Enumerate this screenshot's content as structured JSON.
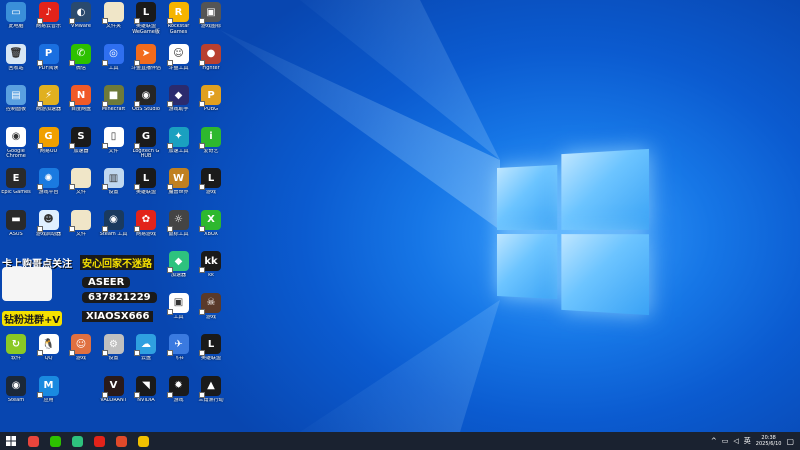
{
  "desktop_icons": [
    {
      "label": "此电脑",
      "color": "#3a8fd9",
      "glyph": "▭"
    },
    {
      "label": "网易云音乐",
      "color": "#e2231a",
      "glyph": "♪"
    },
    {
      "label": "VMware",
      "color": "#2a4a6e",
      "glyph": "◐"
    },
    {
      "label": "文件夹",
      "color": "#f0e6c8",
      "glyph": ""
    },
    {
      "label": "英雄联盟 WeGame版",
      "color": "#1a1a1a",
      "glyph": "L"
    },
    {
      "label": "Rockstar Games",
      "color": "#f5b400",
      "glyph": "R"
    },
    {
      "label": "游戏图标",
      "color": "#555",
      "glyph": "▣"
    },
    {
      "label": "回收站",
      "color": "#d6e6f5",
      "glyph": "🗑"
    },
    {
      "label": "PDF阅读",
      "color": "#1a6fe0",
      "glyph": "P"
    },
    {
      "label": "微信",
      "color": "#2dc100",
      "glyph": "✆"
    },
    {
      "label": "工具",
      "color": "#2f6ff0",
      "glyph": "◎"
    },
    {
      "label": "斗鱼直播伴侣",
      "color": "#f26b1d",
      "glyph": "➤"
    },
    {
      "label": "斗鱼工具",
      "color": "#ffffff",
      "glyph": "☺"
    },
    {
      "label": "Fighter",
      "color": "#b84030",
      "glyph": "●"
    },
    {
      "label": "控制面板",
      "color": "#5aa0e0",
      "glyph": "▤"
    },
    {
      "label": "网游加速器",
      "color": "#e0b020",
      "glyph": "⚡"
    },
    {
      "label": "百度网盘",
      "color": "#f05a28",
      "glyph": "N"
    },
    {
      "label": "Minecraft",
      "color": "#6e7a3a",
      "glyph": "■"
    },
    {
      "label": "OBS Studio",
      "color": "#262626",
      "glyph": "◉"
    },
    {
      "label": "游戏助手",
      "color": "#2b2b6e",
      "glyph": "◆"
    },
    {
      "label": "PUBG",
      "color": "#e0a020",
      "glyph": "P"
    },
    {
      "label": "Google Chrome",
      "color": "#ffffff",
      "glyph": "◉"
    },
    {
      "label": "网易UU",
      "color": "#f0a000",
      "glyph": "G"
    },
    {
      "label": "加速器",
      "color": "#1a1a1a",
      "glyph": "S"
    },
    {
      "label": "文件",
      "color": "#ffffff",
      "glyph": "▯"
    },
    {
      "label": "Logitech G HUB",
      "color": "#1a1a1a",
      "glyph": "G"
    },
    {
      "label": "加速工具",
      "color": "#1aa0c0",
      "glyph": "✦"
    },
    {
      "label": "爱奇艺",
      "color": "#2eb82e",
      "glyph": "i"
    },
    {
      "label": "Epic Games",
      "color": "#2a2a2a",
      "glyph": "E"
    },
    {
      "label": "游戏平台",
      "color": "#1a7ae0",
      "glyph": "✺"
    },
    {
      "label": "文件",
      "color": "#f0e6c8",
      "glyph": ""
    },
    {
      "label": "设置",
      "color": "#c0d8f0",
      "glyph": "▥"
    },
    {
      "label": "英雄联盟",
      "color": "#1a1a1a",
      "glyph": "L"
    },
    {
      "label": "魔兽世界",
      "color": "#c08020",
      "glyph": "W"
    },
    {
      "label": "游戏",
      "color": "#1a1a1a",
      "glyph": "L"
    },
    {
      "label": "ASUS",
      "color": "#2a2a2a",
      "glyph": "▬"
    },
    {
      "label": "游戏启动器",
      "color": "#e0f0ff",
      "glyph": "☻"
    },
    {
      "label": "文件",
      "color": "#f0e6c8",
      "glyph": ""
    },
    {
      "label": "Steam 工具",
      "color": "#1a3a5e",
      "glyph": "◉"
    },
    {
      "label": "网易游戏",
      "color": "#e2231a",
      "glyph": "✿"
    },
    {
      "label": "鼠标工具",
      "color": "#444",
      "glyph": "☼"
    },
    {
      "label": "XBOX",
      "color": "#2eb82e",
      "glyph": "X"
    },
    {
      "label": "",
      "color": "transparent",
      "glyph": ""
    },
    {
      "label": "",
      "color": "transparent",
      "glyph": ""
    },
    {
      "label": "",
      "color": "transparent",
      "glyph": ""
    },
    {
      "label": "",
      "color": "transparent",
      "glyph": ""
    },
    {
      "label": "",
      "color": "transparent",
      "glyph": ""
    },
    {
      "label": "加速器",
      "color": "#2ec27e",
      "glyph": "◆"
    },
    {
      "label": "kk",
      "color": "#1a1a1a",
      "glyph": "kk"
    },
    {
      "label": "",
      "color": "transparent",
      "glyph": ""
    },
    {
      "label": "",
      "color": "transparent",
      "glyph": ""
    },
    {
      "label": "",
      "color": "transparent",
      "glyph": ""
    },
    {
      "label": "",
      "color": "transparent",
      "glyph": ""
    },
    {
      "label": "",
      "color": "transparent",
      "glyph": ""
    },
    {
      "label": "工具",
      "color": "#ffffff",
      "glyph": "▣"
    },
    {
      "label": "游戏",
      "color": "#5a3a2a",
      "glyph": "☠"
    },
    {
      "label": "软件",
      "color": "#8ac926",
      "glyph": "↻"
    },
    {
      "label": "QQ",
      "color": "#ffffff",
      "glyph": "🐧"
    },
    {
      "label": "游戏",
      "color": "#e07040",
      "glyph": "☺"
    },
    {
      "label": "设置",
      "color": "#c0c0c0",
      "glyph": "⚙"
    },
    {
      "label": "云盘",
      "color": "#2fa0e0",
      "glyph": "☁"
    },
    {
      "label": "飞书",
      "color": "#3a7ae0",
      "glyph": "✈"
    },
    {
      "label": "英雄联盟",
      "color": "#1a1a1a",
      "glyph": "L"
    },
    {
      "label": "Steam",
      "color": "#1b2838",
      "glyph": "◉"
    },
    {
      "label": "应用",
      "color": "#1a8ae0",
      "glyph": "M"
    },
    {
      "label": "",
      "color": "transparent",
      "glyph": ""
    },
    {
      "label": "VALORANT",
      "color": "#2a1a1a",
      "glyph": "V"
    },
    {
      "label": "NVIDIA",
      "color": "#1a1a1a",
      "glyph": "◥"
    },
    {
      "label": "游戏",
      "color": "#1a1a1a",
      "glyph": "✹"
    },
    {
      "label": "三角洲行动",
      "color": "#1a1a1a",
      "glyph": "▲"
    }
  ],
  "promo": {
    "line1": "卡上购哥点关注",
    "line2": "安心回家不迷路",
    "name": "ASEER",
    "number": "637821229",
    "line3": "钻粉进群+V",
    "id": "XIAOSX666"
  },
  "taskbar": {
    "items": [
      {
        "name": "start-button",
        "color": "#ffffff"
      },
      {
        "name": "chrome",
        "color": "#e8453c"
      },
      {
        "name": "wechat",
        "color": "#2dc100"
      },
      {
        "name": "app-triangle",
        "color": "#2ec27e"
      },
      {
        "name": "netease",
        "color": "#e2231a"
      },
      {
        "name": "wps",
        "color": "#e04a2a"
      },
      {
        "name": "game",
        "color": "#f0c000"
      }
    ]
  },
  "tray": {
    "arrow": "^",
    "lang": "英",
    "time": "20:38",
    "date": "2025/6/10"
  },
  "colors": {
    "desktop": "#0b5bd0",
    "taskbar": "#1a2230"
  }
}
